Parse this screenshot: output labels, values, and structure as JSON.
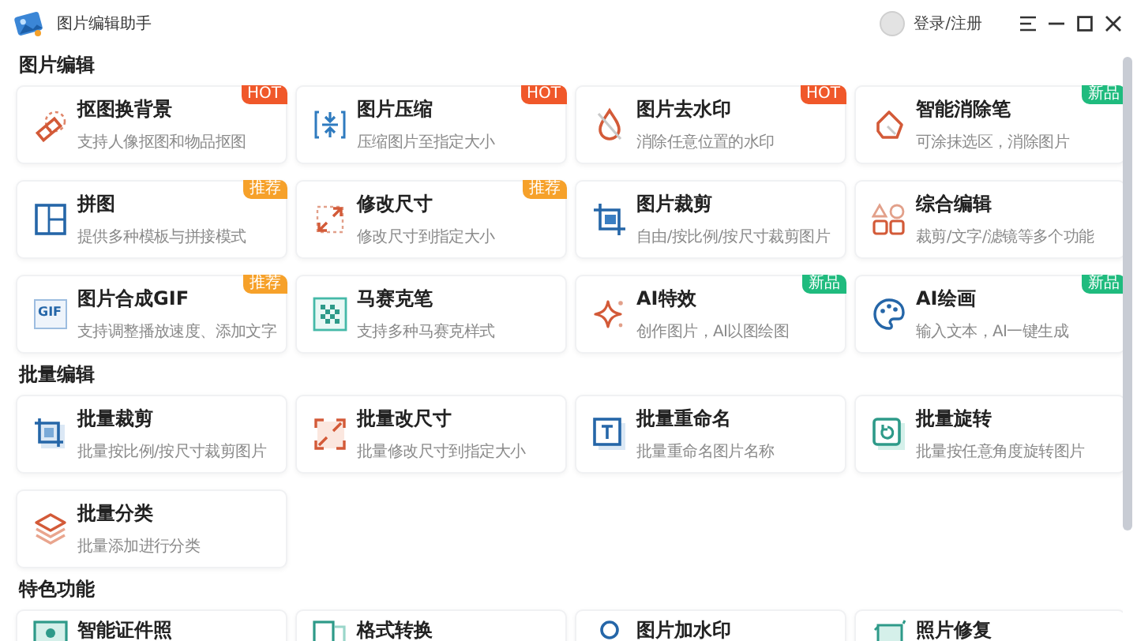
{
  "window": {
    "title": "图片编辑助手",
    "account": "登录/注册"
  },
  "sections": [
    {
      "title": "图片编辑",
      "cards": [
        {
          "title": "抠图换背景",
          "subtitle": "支持人像抠图和物品抠图",
          "badge": {
            "text": "HOT",
            "kind": "hot"
          }
        },
        {
          "title": "图片压缩",
          "subtitle": "压缩图片至指定大小",
          "badge": {
            "text": "HOT",
            "kind": "hot"
          }
        },
        {
          "title": "图片去水印",
          "subtitle": "消除任意位置的水印",
          "badge": {
            "text": "HOT",
            "kind": "hot"
          }
        },
        {
          "title": "智能消除笔",
          "subtitle": "可涂抹选区，消除图片",
          "badge": {
            "text": "新品",
            "kind": "new"
          }
        },
        {
          "title": "拼图",
          "subtitle": "提供多种模板与拼接模式",
          "badge": {
            "text": "推荐",
            "kind": "recommend"
          }
        },
        {
          "title": "修改尺寸",
          "subtitle": "修改尺寸到指定大小",
          "badge": {
            "text": "推荐",
            "kind": "recommend"
          }
        },
        {
          "title": "图片裁剪",
          "subtitle": "自由/按比例/按尺寸裁剪图片"
        },
        {
          "title": "综合编辑",
          "subtitle": "裁剪/文字/滤镜等多个功能"
        },
        {
          "title": "图片合成GIF",
          "subtitle": "支持调整播放速度、添加文字",
          "icon_label": "GIF",
          "badge": {
            "text": "推荐",
            "kind": "recommend"
          }
        },
        {
          "title": "马赛克笔",
          "subtitle": "支持多种马赛克样式"
        },
        {
          "title": "AI特效",
          "subtitle": "创作图片，AI以图绘图",
          "badge": {
            "text": "新品",
            "kind": "new"
          }
        },
        {
          "title": "AI绘画",
          "subtitle": "输入文本，AI一键生成",
          "badge": {
            "text": "新品",
            "kind": "new"
          }
        }
      ]
    },
    {
      "title": "批量编辑",
      "cards": [
        {
          "title": "批量裁剪",
          "subtitle": "批量按比例/按尺寸裁剪图片"
        },
        {
          "title": "批量改尺寸",
          "subtitle": "批量修改尺寸到指定大小"
        },
        {
          "title": "批量重命名",
          "subtitle": "批量重命名图片名称"
        },
        {
          "title": "批量旋转",
          "subtitle": "批量按任意角度旋转图片"
        },
        {
          "title": "批量分类",
          "subtitle": "批量添加进行分类"
        }
      ]
    },
    {
      "title": "特色功能",
      "cards": [
        {
          "title": "智能证件照"
        },
        {
          "title": "格式转换"
        },
        {
          "title": "图片加水印"
        },
        {
          "title": "照片修复"
        }
      ]
    }
  ]
}
